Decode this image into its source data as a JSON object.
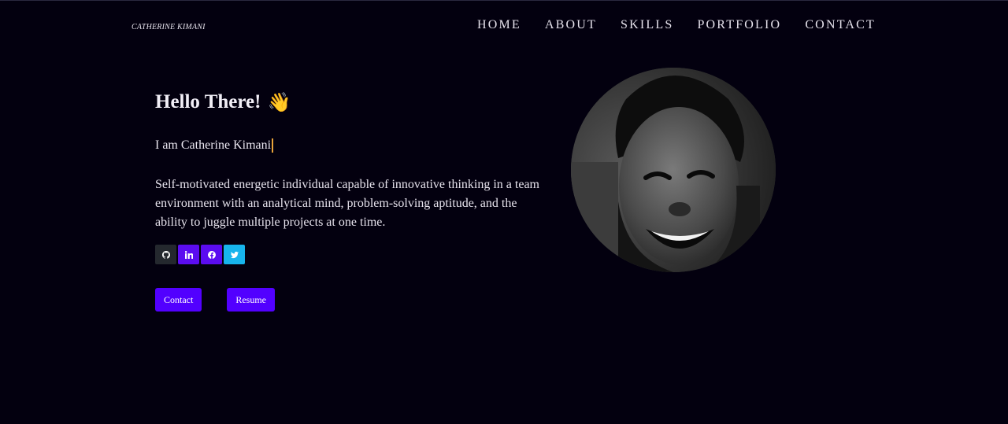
{
  "brand": "CATHERINE KIMANI",
  "nav": {
    "items": [
      "HOME",
      "ABOUT",
      "SKILLS",
      "PORTFOLIO",
      "CONTACT"
    ]
  },
  "hero": {
    "greeting": "Hello There!",
    "greeting_icon": "waving-hand-icon",
    "typed_text": "I am Catherine Kimani",
    "bio": "Self-motivated energetic individual capable of innovative thinking in a team environment with an analytical mind, problem-solving aptitude, and the ability to juggle multiple projects at one time.",
    "socials": [
      {
        "name": "github",
        "icon": "github-icon",
        "color": "#24282e"
      },
      {
        "name": "linkedin",
        "icon": "linkedin-icon",
        "color": "#5b0cf0"
      },
      {
        "name": "facebook",
        "icon": "facebook-icon",
        "color": "#5b0cf0"
      },
      {
        "name": "twitter",
        "icon": "twitter-icon",
        "color": "#17b4ec"
      }
    ],
    "buttons": {
      "contact": "Contact",
      "resume": "Resume"
    }
  },
  "colors": {
    "background": "#03000f",
    "accent": "#5200ff",
    "caret": "#e8a33a"
  }
}
